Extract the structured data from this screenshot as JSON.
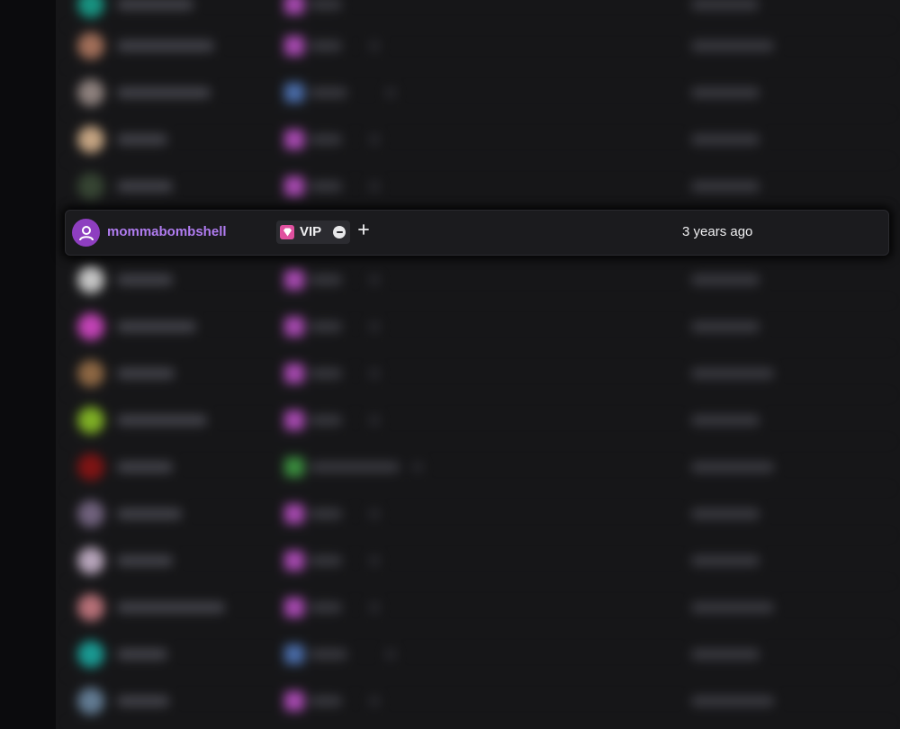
{
  "focused_user": {
    "username": "mommabombshell",
    "badge_label": "VIP",
    "joined": "3 years ago"
  },
  "icons": {
    "avatar": "user-silhouette-icon",
    "vip": "gem-icon",
    "remove": "minus-circle-icon",
    "add": "plus-icon"
  },
  "colors": {
    "username": "#b07cf0",
    "avatar_bg": "#8e3ec0",
    "vip_badge": "#e0509f"
  }
}
